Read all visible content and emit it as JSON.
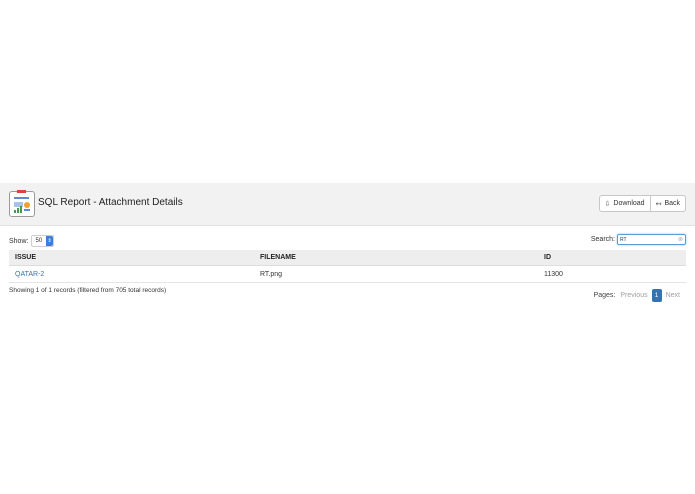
{
  "header": {
    "title": "SQL Report - Attachment Details",
    "download_label": "Download",
    "back_label": "Back"
  },
  "controls": {
    "show_label": "Show:",
    "show_value": "50",
    "search_label": "Search:",
    "search_value": "RT"
  },
  "table": {
    "columns": [
      "ISSUE",
      "FILENAME",
      "ID"
    ],
    "rows": [
      {
        "issue": "QATAR-2",
        "filename": "RT.png",
        "id": "11300"
      }
    ]
  },
  "footer": {
    "records_text": "Showing 1 of 1 records (filtered from 705 total records)",
    "pages_label": "Pages:",
    "previous_label": "Previous",
    "current_page": "1",
    "next_label": "Next"
  },
  "colors": {
    "accent": "#3572b0",
    "header_bg": "#f2f2f2"
  }
}
